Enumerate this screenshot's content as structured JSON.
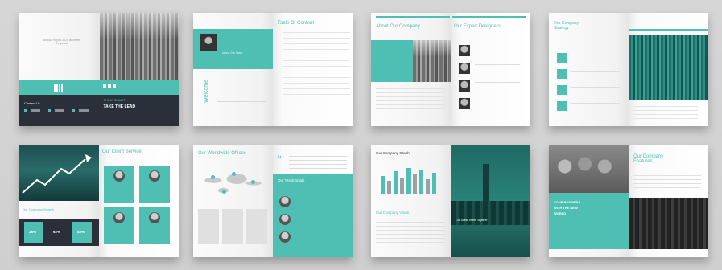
{
  "spreads": {
    "s1": {
      "cover_left_text": "Annual Report 2024 Business Proposal",
      "contact_label": "Contact Us",
      "right_bar_label": "THINK SMART",
      "right_bar_title": "TAKE THE LEAD"
    },
    "s2": {
      "left_caption": "About Our Team",
      "right_title": "Table Of Content",
      "vertical_text": "Welcome"
    },
    "s3": {
      "left_title": "About Our Company",
      "right_title": "Our Expert Designers"
    },
    "s4": {
      "left_title": "Our Company Strategy"
    },
    "s5": {
      "right_title": "Our Client Service",
      "left_label": "Our Company Growth",
      "circle_values": [
        "35%",
        "62%",
        "48%"
      ]
    },
    "s6": {
      "left_title": "Our Worldwide Offices",
      "right_title": "Our Testimonials"
    },
    "s7": {
      "left_title": "Our Company Graph",
      "left_sub": "Our Company Vision",
      "right_caption": "Our Great Team Together"
    },
    "s8": {
      "left_text": "YOUR BUSINESS WITH THE NEW WORLD",
      "right_title": "Our Company Features"
    }
  },
  "colors": {
    "accent": "#4fbfb4",
    "dark": "#2b2f3a",
    "background": "#d3d3d3"
  }
}
